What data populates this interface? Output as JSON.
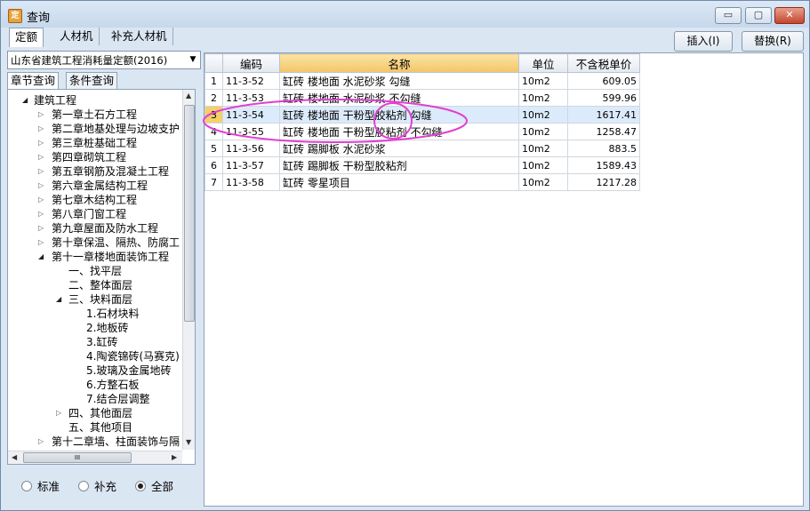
{
  "window": {
    "title": "查询",
    "app_icon": "app-icon",
    "controls": {
      "minimize": "▭",
      "maximize": "▢",
      "close": "✕"
    }
  },
  "top_tabs": [
    "定额",
    "人材机",
    "补充人材机"
  ],
  "actions": {
    "insert": "插入(I)",
    "replace": "替换(R)"
  },
  "left": {
    "quota_select": "山东省建筑工程消耗量定额(2016)",
    "sub_tabs": [
      "章节查询",
      "条件查询"
    ],
    "tree": {
      "root": "建筑工程",
      "chapters": [
        "第一章土石方工程",
        "第二章地基处理与边坡支护",
        "第三章桩基础工程",
        "第四章砌筑工程",
        "第五章钢筋及混凝土工程",
        "第六章金属结构工程",
        "第七章木结构工程",
        "第八章门窗工程",
        "第九章屋面及防水工程",
        "第十章保温、隔热、防腐工",
        "第十一章楼地面装饰工程"
      ],
      "ch11_sections": [
        "一、找平层",
        "二、整体面层",
        "三、块料面层"
      ],
      "block_items": [
        "1.石材块料",
        "2.地板砖",
        "3.缸砖",
        "4.陶瓷锦砖(马赛克)",
        "5.玻璃及金属地砖",
        "6.方整石板",
        "7.结合层调整"
      ],
      "ch11_more": [
        "四、其他面层",
        "五、其他项目"
      ],
      "ch12": "第十二章墙、柱面装饰与隔"
    },
    "scroll_thumb_glyph": "III",
    "filter": {
      "options": [
        "标准",
        "补充",
        "全部"
      ],
      "selected": "全部"
    }
  },
  "table": {
    "columns": [
      "编码",
      "名称",
      "单位",
      "不含税单价"
    ],
    "selected_row": 3,
    "rows": [
      {
        "no": "1",
        "code": "11-3-52",
        "name": "缸砖 楼地面 水泥砂浆 勾缝",
        "unit": "10m2",
        "price": "609.05"
      },
      {
        "no": "2",
        "code": "11-3-53",
        "name": "缸砖 楼地面 水泥砂浆 不勾缝",
        "unit": "10m2",
        "price": "599.96"
      },
      {
        "no": "3",
        "code": "11-3-54",
        "name": "缸砖 楼地面 干粉型胶粘剂 勾缝",
        "unit": "10m2",
        "price": "1617.41"
      },
      {
        "no": "4",
        "code": "11-3-55",
        "name": "缸砖 楼地面 干粉型胶粘剂 不勾缝",
        "unit": "10m2",
        "price": "1258.47"
      },
      {
        "no": "5",
        "code": "11-3-56",
        "name": "缸砖 踢脚板 水泥砂浆",
        "unit": "10m2",
        "price": "883.5"
      },
      {
        "no": "6",
        "code": "11-3-57",
        "name": "缸砖 踢脚板 干粉型胶粘剂",
        "unit": "10m2",
        "price": "1589.43"
      },
      {
        "no": "7",
        "code": "11-3-58",
        "name": "缸砖 零星项目",
        "unit": "10m2",
        "price": "1217.28"
      }
    ]
  },
  "colors": {
    "header_highlight": "#f3c666",
    "selected_row": "#dcebfb",
    "annotation": "#e040d0"
  }
}
